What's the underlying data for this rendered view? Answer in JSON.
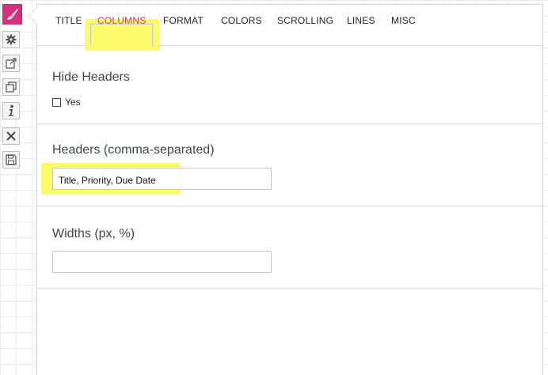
{
  "toolbar": {
    "tools": [
      {
        "name": "brush-icon",
        "active": true
      },
      {
        "name": "gear-icon",
        "active": false
      },
      {
        "name": "external-link-icon",
        "active": false
      },
      {
        "name": "copy-icon",
        "active": false
      },
      {
        "name": "info-icon",
        "active": false
      },
      {
        "name": "close-icon",
        "active": false
      },
      {
        "name": "save-icon",
        "active": false
      }
    ],
    "active_color": "#d5307a"
  },
  "tabs": [
    {
      "label": "TITLE"
    },
    {
      "label": "COLUMNS",
      "selected": true
    },
    {
      "label": "FORMAT"
    },
    {
      "label": "COLORS"
    },
    {
      "label": "SCROLLING"
    },
    {
      "label": "LINES"
    },
    {
      "label": "MISC"
    }
  ],
  "hide_headers": {
    "label": "Hide Headers",
    "checkbox_label": "Yes",
    "checked": false
  },
  "headers": {
    "label": "Headers (comma-separated)",
    "value": "Title, Priority, Due Date"
  },
  "widths": {
    "label": "Widths (px, %)",
    "value": ""
  },
  "highlight_color": "#fbfb6a",
  "accent_color": "#d0377a"
}
